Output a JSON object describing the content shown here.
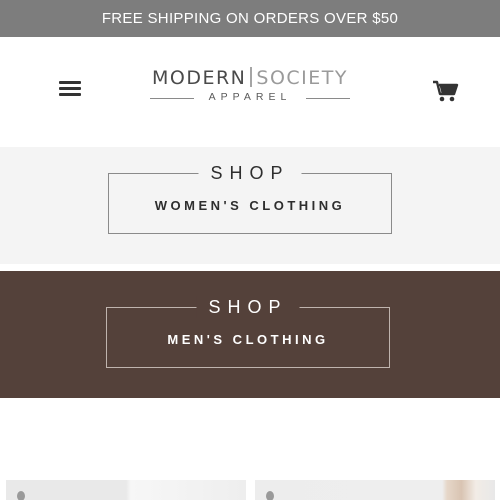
{
  "announcement": {
    "text": "FREE SHIPPING ON ORDERS OVER $50"
  },
  "header": {
    "menu_icon": "hamburger-menu-icon",
    "cart_icon": "shopping-cart-icon",
    "logo": {
      "word1": "MODERN",
      "word2": "SOCIETY",
      "sub": "APPAREL"
    }
  },
  "banners": [
    {
      "shop_label": "SHOP",
      "category": "WOMEN'S CLOTHING",
      "background": "#f4f4f4"
    },
    {
      "shop_label": "SHOP",
      "category": "MEN'S CLOTHING",
      "background": "#54413a"
    }
  ],
  "colors": {
    "announcement_bar": "#7d7d7d",
    "mens_banner": "#54413a",
    "womens_banner": "#f4f4f4"
  }
}
